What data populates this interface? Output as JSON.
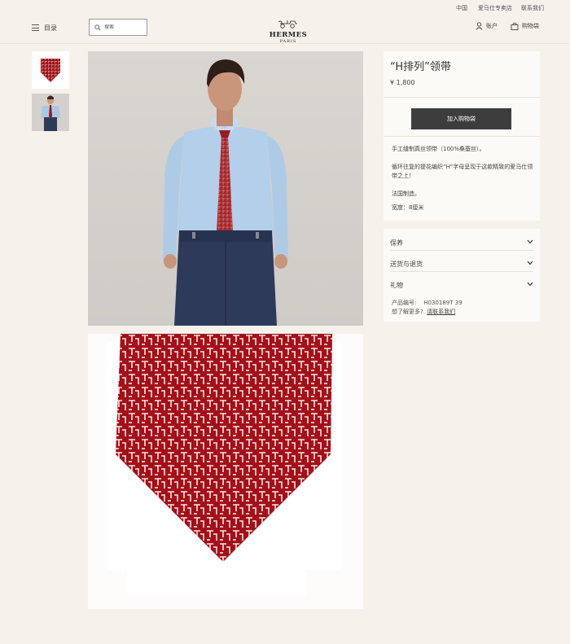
{
  "topbar": {
    "region": "中国",
    "stores": "爱马仕专卖店",
    "contact": "联系我们"
  },
  "header": {
    "menu_label": "目录",
    "search_placeholder": "搜索",
    "logo_word": "HERMES",
    "logo_city": "PARIS",
    "account_label": "账户",
    "cart_label": "购物袋"
  },
  "product": {
    "title": "“H排列”领带",
    "price": "¥ 1,800",
    "add_to_cart": "加入购物袋",
    "description": [
      "手工缝制真丝领带（100%桑蚕丝）。",
      "循环往复的提花编织“H”字母呈现于这款精致的爱马仕领带之上！",
      "法国制造。",
      "宽度：8厘米"
    ]
  },
  "accordion": [
    {
      "label": "保养"
    },
    {
      "label": "送货与退货"
    },
    {
      "label": "礼物"
    }
  ],
  "meta": {
    "ref_label": "产品编号:",
    "ref_value": "H030189T 39",
    "question": "想了解更多?",
    "contact_link": "请联系我们"
  },
  "colors": {
    "background": "#f6f1eb",
    "panel": "#fcfaf6",
    "button": "#3d3d3d",
    "tie_red": "#a01418"
  }
}
